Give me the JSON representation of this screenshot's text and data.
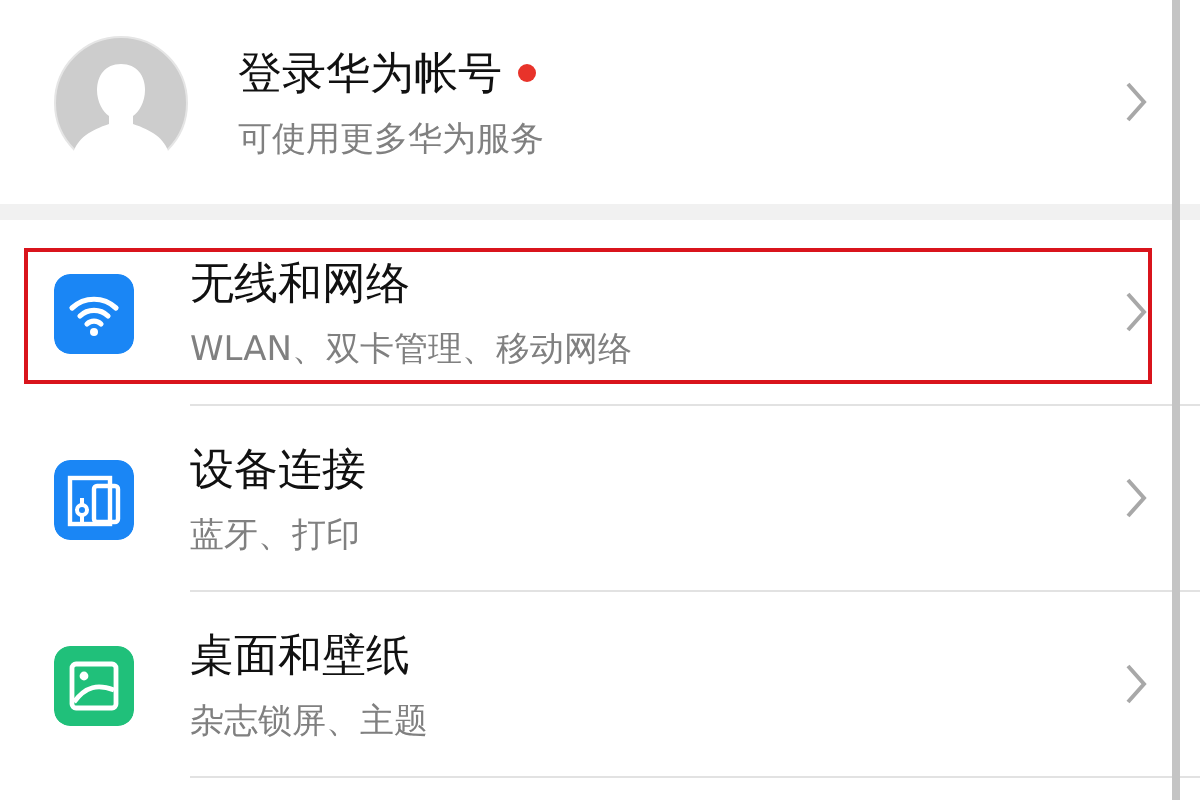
{
  "account": {
    "title": "登录华为帐号",
    "subtitle": "可使用更多华为服务",
    "notification_dot": true
  },
  "settings": [
    {
      "title": "无线和网络",
      "subtitle": "WLAN、双卡管理、移动网络",
      "color": "#1a86f5",
      "highlighted": true
    },
    {
      "title": "设备连接",
      "subtitle": "蓝牙、打印",
      "color": "#1a86f5",
      "highlighted": false
    },
    {
      "title": "桌面和壁纸",
      "subtitle": "杂志锁屏、主题",
      "color": "#20c07a",
      "highlighted": false
    }
  ]
}
